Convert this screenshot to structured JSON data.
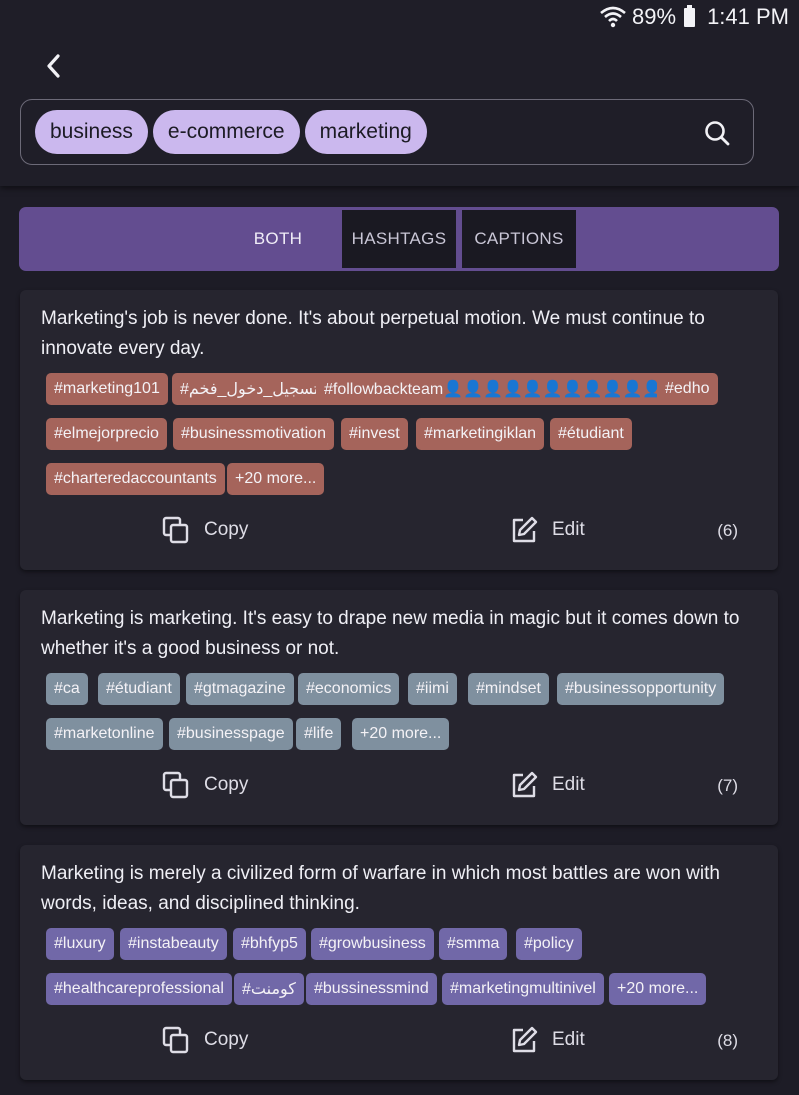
{
  "status_bar": {
    "battery": "89%",
    "time": "1:41 PM"
  },
  "search": {
    "chips": [
      "business",
      "e-commerce",
      "marketing"
    ]
  },
  "tabs": [
    "BOTH",
    "HASHTAGS",
    "CAPTIONS"
  ],
  "actions": {
    "copy": "Copy",
    "edit": "Edit"
  },
  "cards": [
    {
      "quote": "Marketing's job is never done. It's about perpetual motion. We must continue to innovate every day.",
      "tags": [
        "#marketing101",
        "#تسجيل_دخول_فخم",
        "#followbackteam👤👤👤👤👤👤👤👤👤👤👤",
        "#edho",
        "#elmejorprecio",
        "#businessmotivation",
        "#invest",
        "#marketingiklan",
        "#étudiant",
        "#charteredaccountants",
        "+20 more..."
      ],
      "count": "(6)",
      "tag_color": "#a5645b"
    },
    {
      "quote": "Marketing is marketing. It's easy to drape new media in magic but it comes down to whether it's a good business or not.",
      "tags": [
        "#ca",
        "#étudiant",
        "#gtmagazine",
        "#economics",
        "#iimi",
        "#mindset",
        "#businessopportunity",
        "#marketonline",
        "#businesspage",
        "#life",
        "+20 more..."
      ],
      "count": "(7)",
      "tag_color": "#7f909f"
    },
    {
      "quote": "Marketing is merely a civilized form of warfare in which most battles are won with words, ideas, and disciplined thinking.",
      "tags": [
        "#luxury",
        "#instabeauty",
        "#bhfyp5",
        "#growbusiness",
        "#smma",
        "#policy",
        "#healthcareprofessional",
        "#كومنت",
        "#bussinessmind",
        "#marketingmultinivel",
        "+20 more..."
      ],
      "count": "(8)",
      "tag_color": "#7168a8"
    }
  ]
}
